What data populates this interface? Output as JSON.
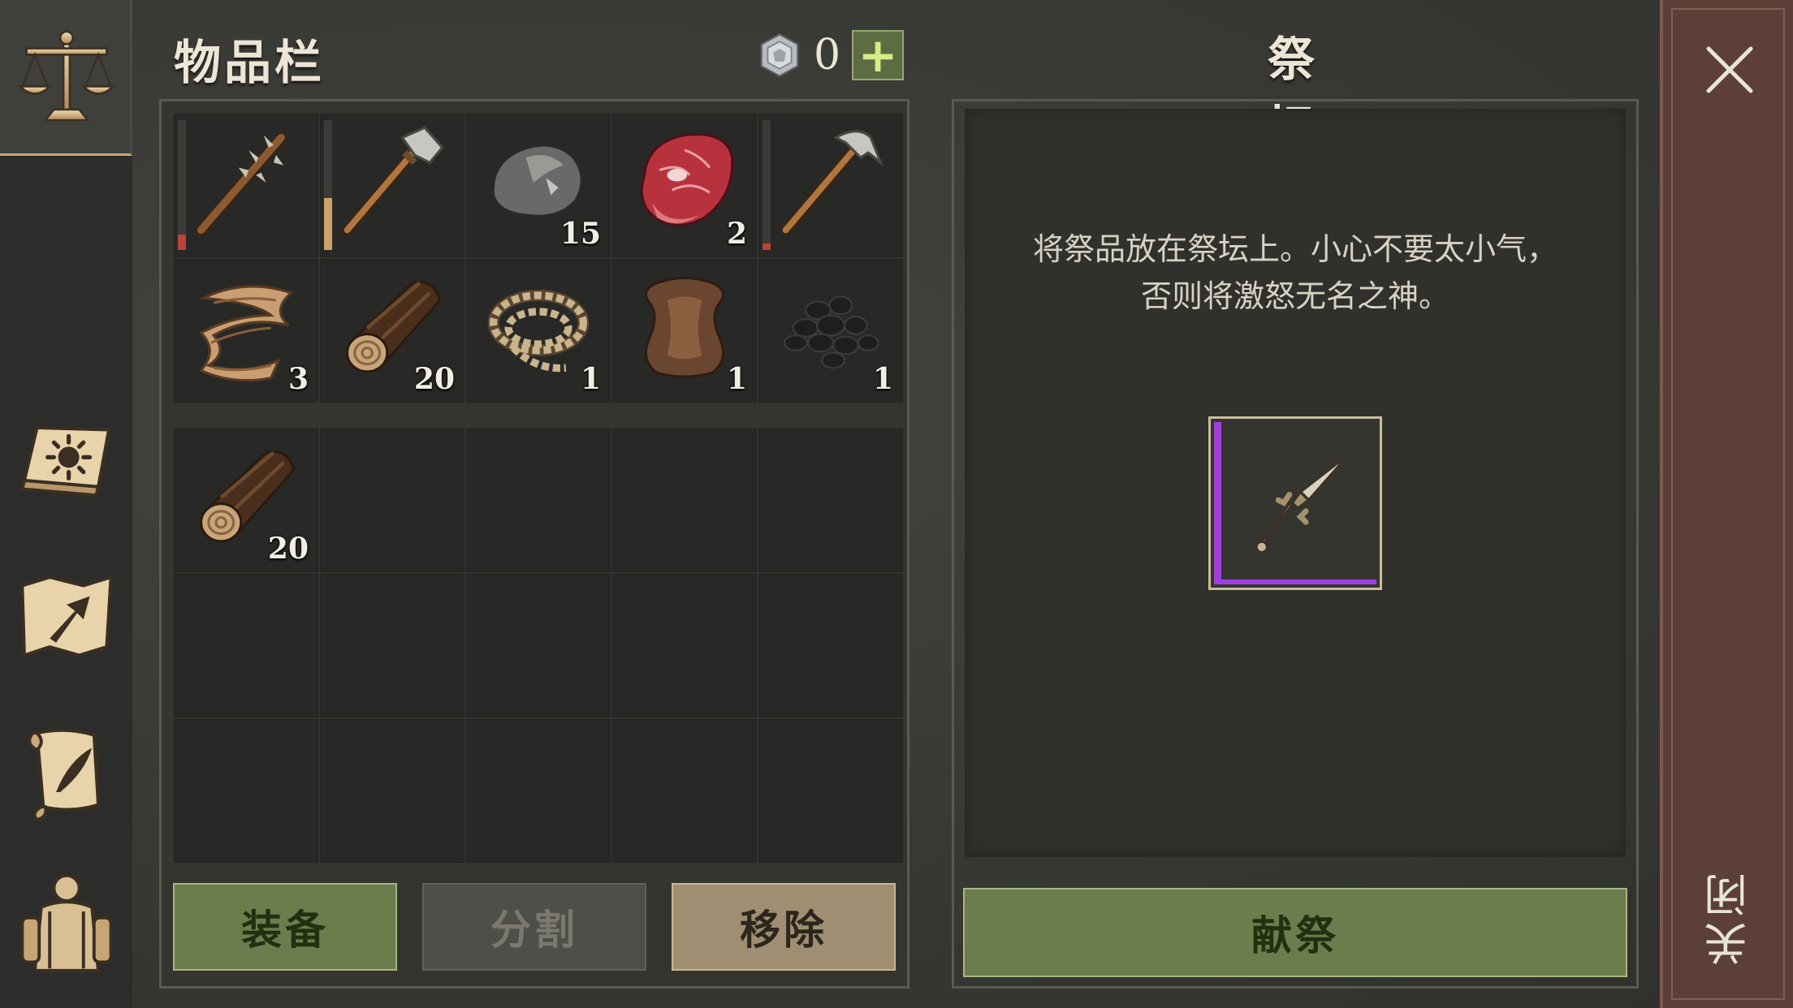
{
  "inventory": {
    "title": "物品栏",
    "currency_value": "0",
    "add_label": "+",
    "slots_top": [
      {
        "icon": "spiked-club-icon",
        "count": "",
        "durability": 0.12,
        "durability_color": "#b8443a"
      },
      {
        "icon": "stone-hatchet-icon",
        "count": "",
        "durability": 0.4,
        "durability_color": "#c9a36a"
      },
      {
        "icon": "stone-icon",
        "count": "15"
      },
      {
        "icon": "raw-meat-icon",
        "count": "2"
      },
      {
        "icon": "pickaxe-icon",
        "count": "",
        "durability": 0.05,
        "durability_color": "#b8443a"
      },
      {
        "icon": "plant-fiber-icon",
        "count": "3"
      },
      {
        "icon": "log-icon",
        "count": "20"
      },
      {
        "icon": "rope-icon",
        "count": "1"
      },
      {
        "icon": "animal-hide-icon",
        "count": "1"
      },
      {
        "icon": "coal-icon",
        "count": "1"
      }
    ],
    "slots_bottom": [
      {
        "icon": "log-icon",
        "count": "20"
      }
    ],
    "buttons": {
      "equip": "装备",
      "split": "分割",
      "remove": "移除"
    }
  },
  "altar": {
    "title": "祭坛",
    "description_line1": "将祭品放在祭坛上。小心不要太小气，",
    "description_line2": "否则将激怒无名之神。",
    "offering": {
      "icon": "bone-dagger-icon",
      "rarity_color": "#a13fe0"
    },
    "sacrifice_button": "献祭"
  },
  "close": {
    "label": "关闭"
  },
  "sidebar": {
    "items": [
      "scales-icon",
      "sun-book-icon",
      "map-arrow-icon",
      "scroll-quill-icon",
      "backpack-character-icon"
    ]
  }
}
